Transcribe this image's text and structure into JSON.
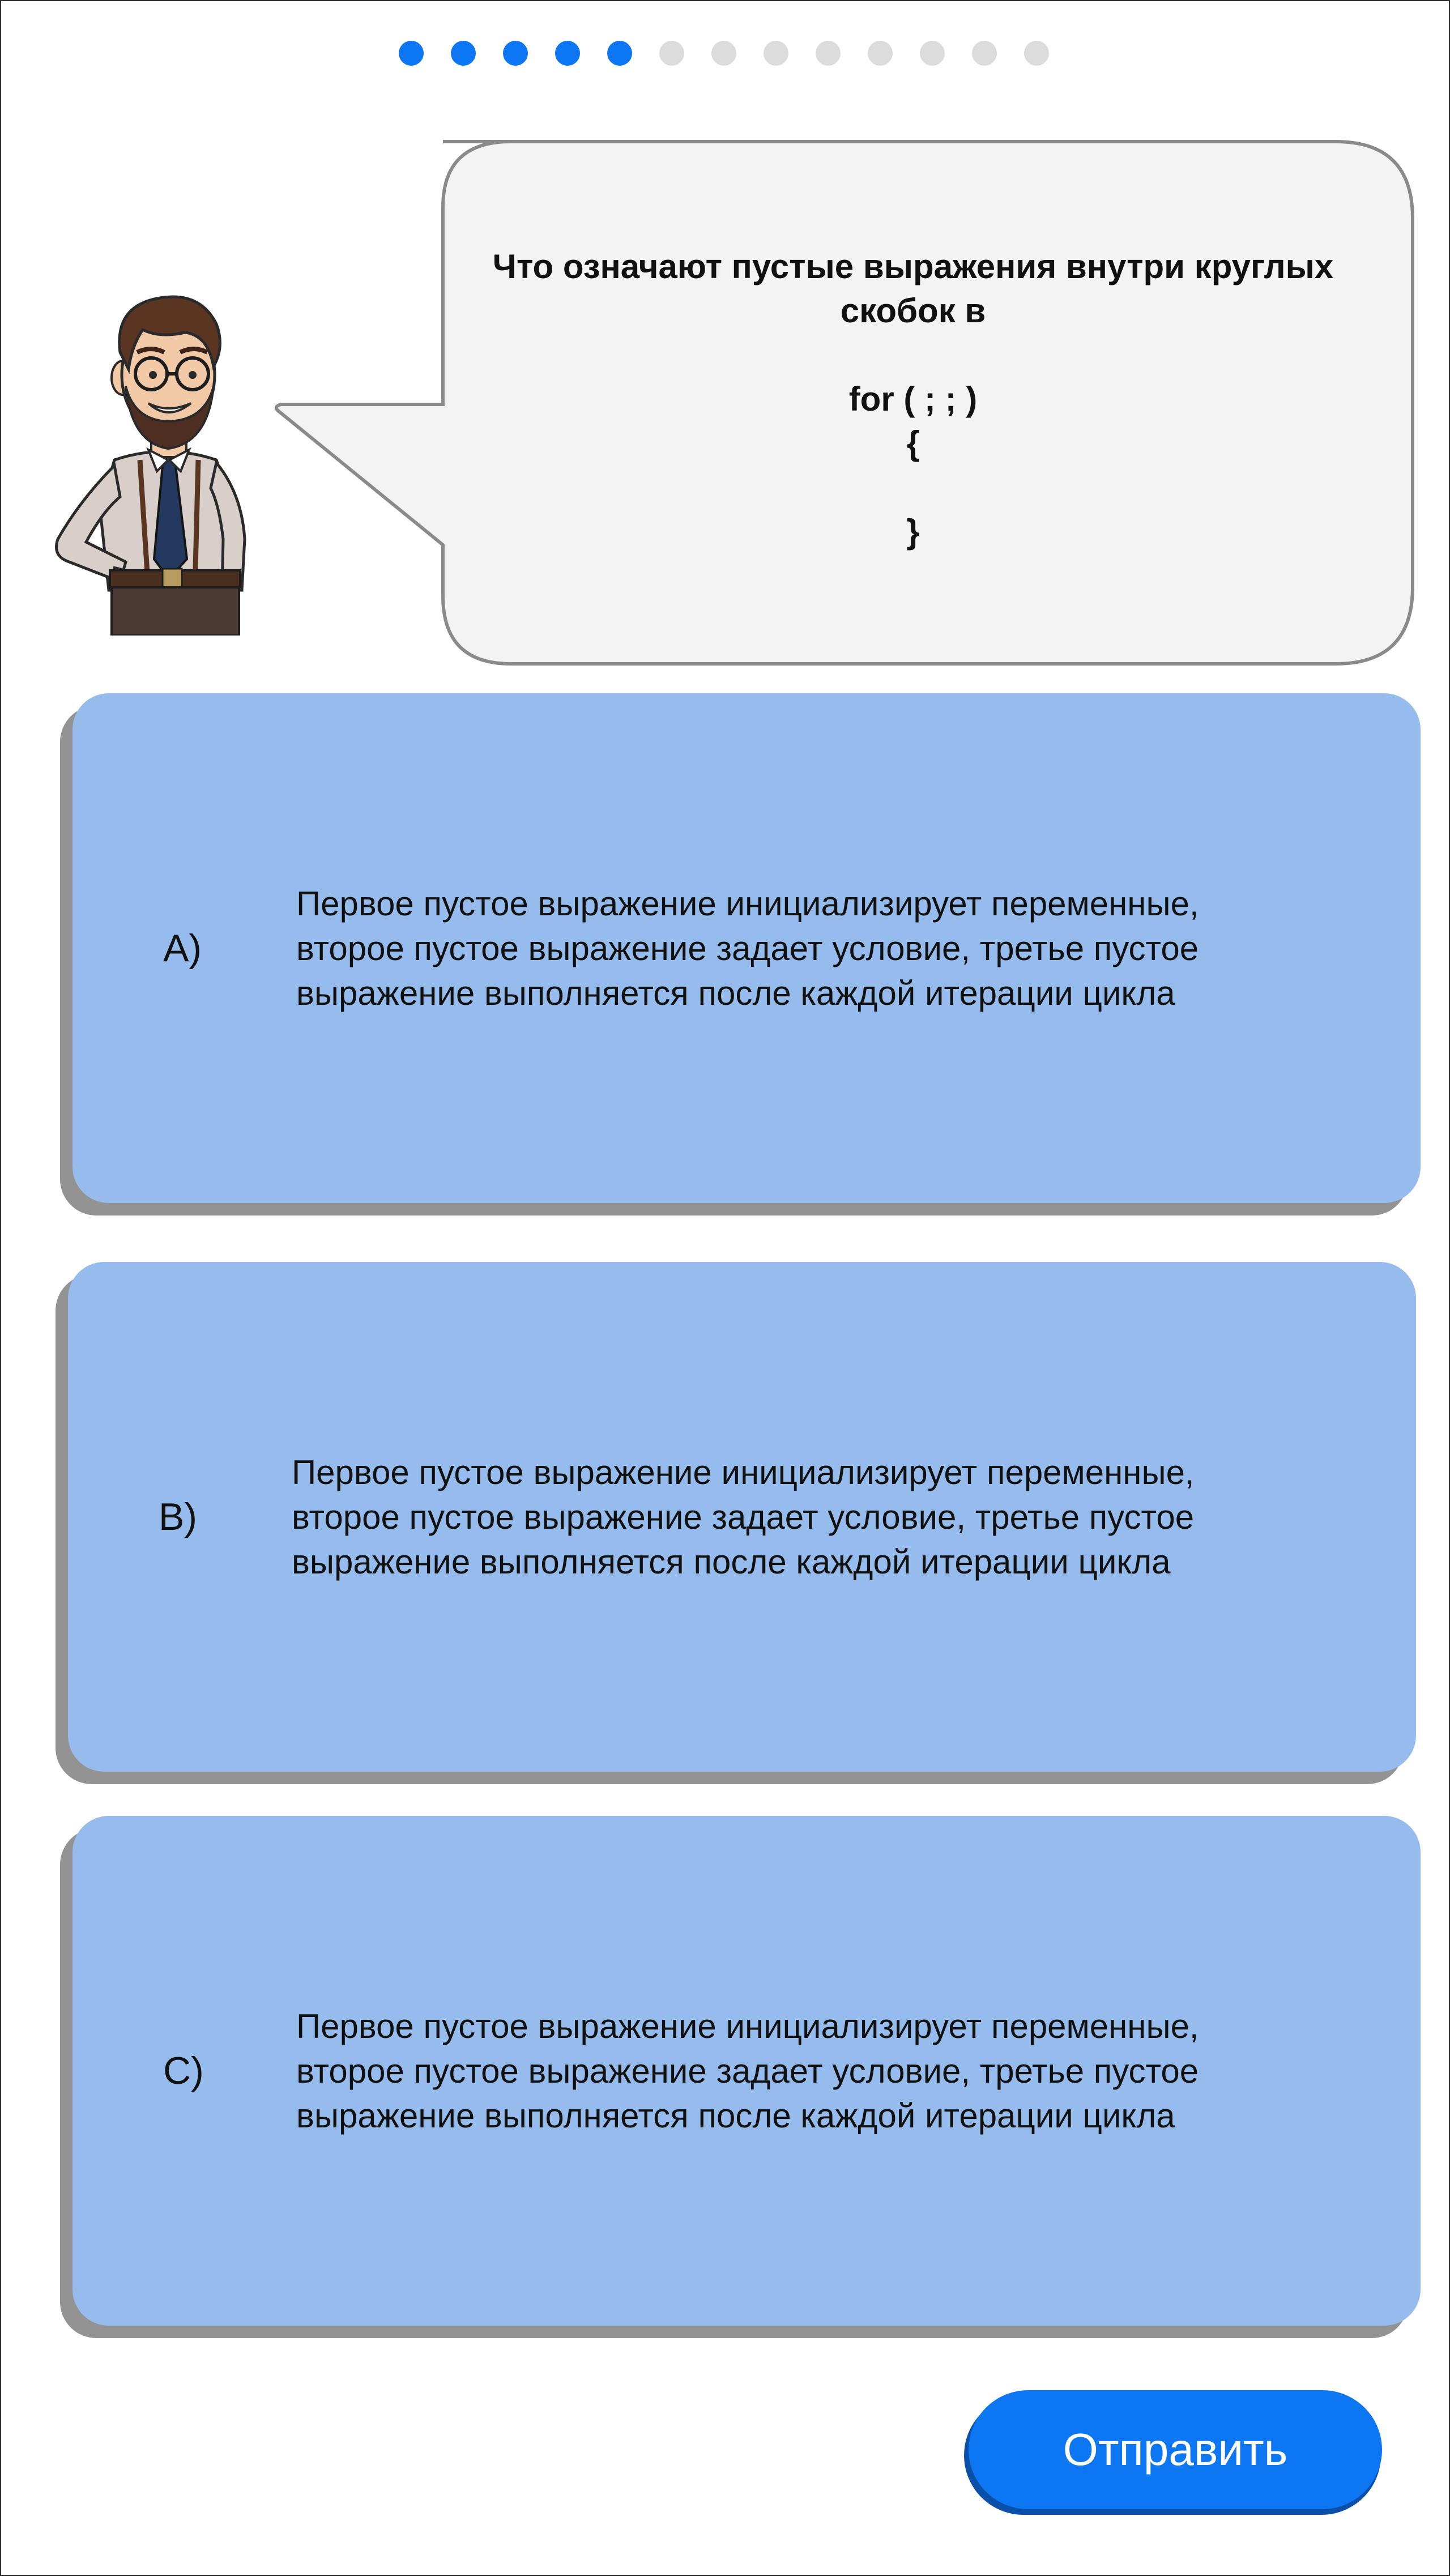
{
  "progress": {
    "total": 13,
    "completed": 5,
    "active_color": "#0d76f2",
    "inactive_color": "#dcdcdc"
  },
  "mascot": {
    "icon": "teacher-mascot-icon"
  },
  "question": {
    "lines": [
      "Что означают пустые выражения внутри круглых",
      "скобок в",
      "",
      "for (  ;  ;  )",
      "{",
      "",
      "}"
    ]
  },
  "options": [
    {
      "letter": "A)",
      "lines": [
        "Первое пустое выражение инициализирует переменные,",
        "второе пустое выражение задает условие, третье пустое",
        "выражение выполняется после каждой итерации цикла"
      ]
    },
    {
      "letter": "B)",
      "lines": [
        "Первое пустое выражение инициализирует переменные,",
        "второе пустое выражение задает условие, третье пустое",
        "выражение выполняется после каждой итерации цикла"
      ]
    },
    {
      "letter": "C)",
      "lines": [
        "Первое пустое выражение инициализирует переменные,",
        "второе пустое выражение задает условие, третье пустое",
        "выражение выполняется после каждой итерации цикла"
      ]
    }
  ],
  "submit": {
    "label": "Отправить"
  },
  "colors": {
    "card_bg": "#95bcec",
    "card_shadow": "#939393",
    "bubble_bg": "#f3f3f3",
    "bubble_border": "#8a8a8a",
    "button_bg": "#0d76f2"
  }
}
